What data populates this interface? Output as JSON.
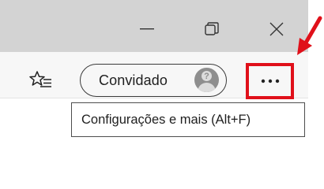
{
  "window_controls": {
    "minimize_icon": "minimize-icon",
    "restore_icon": "restore-icon",
    "close_icon": "close-icon"
  },
  "toolbar": {
    "favorites_icon": "favorites-list-icon",
    "profile": {
      "label": "Convidado",
      "avatar_icon": "guest-avatar-icon",
      "avatar_glyph": "?"
    },
    "more_icon": "more-horizontal-icon"
  },
  "tooltip": {
    "text": "Configurações e mais (Alt+F)"
  },
  "annotation": {
    "arrow_color": "#e0101a",
    "highlight_color": "#e0101a"
  }
}
